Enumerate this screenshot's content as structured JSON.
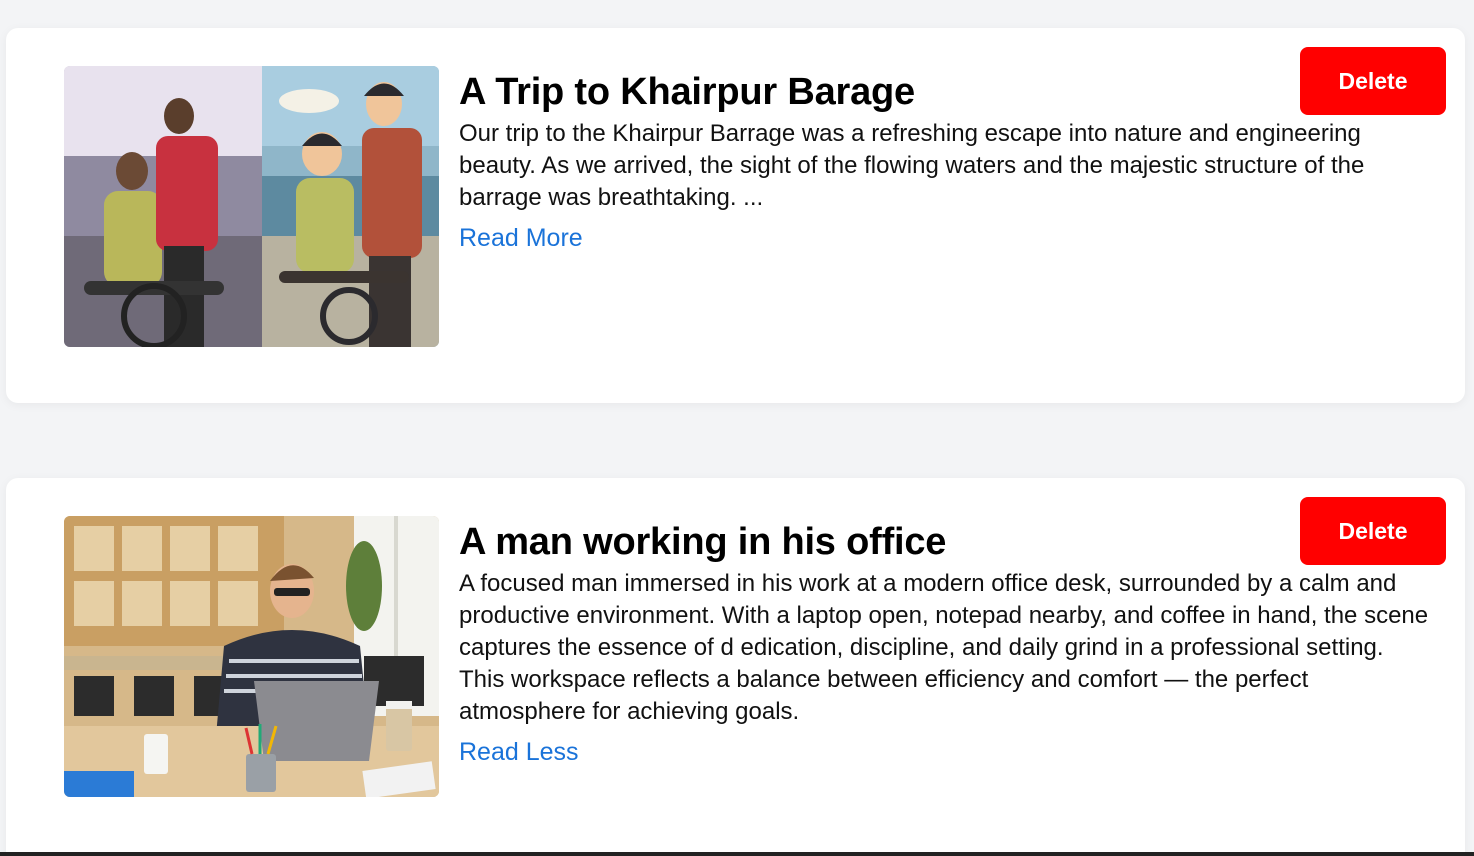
{
  "colors": {
    "page_bg": "#f3f4f6",
    "card_bg": "#ffffff",
    "delete_bg": "#ff0000",
    "link": "#1a73d9"
  },
  "posts": [
    {
      "title": "A Trip to Khairpur Barage",
      "description": "Our trip to the Khairpur Barrage was a refreshing escape into nature and engineering beauty. As we arrived, the sight of the flowing waters and the majestic structure of the barrage was breathtaking. ...",
      "toggle_label": "Read More",
      "delete_label": "Delete",
      "image_icon": "photo-two-boys-on-bicycle"
    },
    {
      "title": "A man working in his office",
      "description": "A focused man immersed in his work at a modern office desk, surrounded by a calm and productive environment. With a laptop open, notepad nearby, and coffee in hand, the scene captures the essence of d edication, discipline, and daily grind in a professional setting. This workspace reflects a balance between efficiency and comfort — the perfect atmosphere for achieving goals.",
      "toggle_label": "Read Less",
      "delete_label": "Delete",
      "image_icon": "photo-man-with-laptop"
    }
  ]
}
